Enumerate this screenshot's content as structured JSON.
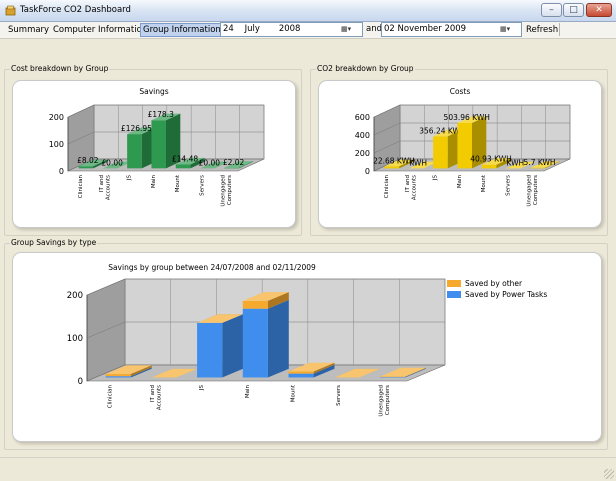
{
  "window": {
    "title": "TaskForce CO2 Dashboard"
  },
  "menu": {
    "summary": "Summary",
    "computer_information": "Computer Information",
    "group_information": "Group Information",
    "and_label": "and",
    "refresh": "Refresh"
  },
  "date_from": {
    "value": "24    July       2008"
  },
  "date_to": {
    "value": "02 November 2009"
  },
  "groups": {
    "cost": "Cost breakdown by Group",
    "co2": "CO2 breakdown by Group",
    "savings": "Group Savings by type"
  },
  "colors": {
    "savings": "#2e9a50",
    "costs": "#f2cc00",
    "power_tasks": "#3f8eee",
    "other": "#f5aa2e"
  },
  "chart_data": [
    {
      "type": "bar",
      "title": "Savings",
      "categories": [
        "Clinician",
        "IT and Accounts",
        "JS",
        "Main",
        "Mount",
        "Servers",
        "Unengaged Computers"
      ],
      "category_labels": [
        [
          "Clinician"
        ],
        [
          "IT and",
          "Accounts"
        ],
        [
          "JS"
        ],
        [
          "Main"
        ],
        [
          "Mount"
        ],
        [
          "Servers"
        ],
        [
          "Unengaged",
          "Computers"
        ]
      ],
      "values": [
        8.02,
        0.0,
        126.95,
        178.3,
        14.48,
        0.0,
        2.02
      ],
      "data_labels": [
        "£8.02",
        "£0.00",
        "£126.95",
        "£178.3",
        "£14.48",
        "£0.00",
        "£2.02"
      ],
      "yticks": [
        0,
        100,
        200
      ],
      "ylim": [
        0,
        200
      ]
    },
    {
      "type": "bar",
      "title": "Costs",
      "categories": [
        "Clinician",
        "IT and Accounts",
        "JS",
        "Main",
        "Mount",
        "Servers",
        "Unengaged Computers"
      ],
      "category_labels": [
        [
          "Clinician"
        ],
        [
          "IT and",
          "Accounts"
        ],
        [
          "JS"
        ],
        [
          "Main"
        ],
        [
          "Mount"
        ],
        [
          "Servers"
        ],
        [
          "Unengaged",
          "Computers"
        ]
      ],
      "values": [
        22.68,
        0,
        356.24,
        503.96,
        40.93,
        0,
        5.7
      ],
      "data_labels": [
        "22.68 KWH",
        "KWH",
        "356.24 KWH",
        "503.96 KWH",
        "40.93 KWH",
        "KWH",
        "5.7 KWH"
      ],
      "yticks": [
        0,
        200,
        400,
        600
      ],
      "ylim": [
        0,
        600
      ]
    },
    {
      "type": "bar",
      "title": "Savings by group between 24/07/2008 and 02/11/2009",
      "categories": [
        "Clinician",
        "IT and Accounts",
        "JS",
        "Main",
        "Mount",
        "Servers",
        "Unengaged Computers"
      ],
      "category_labels": [
        [
          "Clinician"
        ],
        [
          "IT and",
          "Accounts"
        ],
        [
          "JS"
        ],
        [
          "Main"
        ],
        [
          "Mount"
        ],
        [
          "Servers"
        ],
        [
          "Unengaged",
          "Computers"
        ]
      ],
      "series": [
        {
          "name": "Saved by Power Tasks",
          "values": [
            3,
            0,
            127,
            160,
            9,
            0,
            1
          ]
        },
        {
          "name": "Saved by other",
          "values": [
            5,
            0,
            0,
            18,
            5,
            0,
            1
          ]
        }
      ],
      "yticks": [
        0,
        100,
        200
      ],
      "ylim": [
        0,
        200
      ]
    }
  ]
}
